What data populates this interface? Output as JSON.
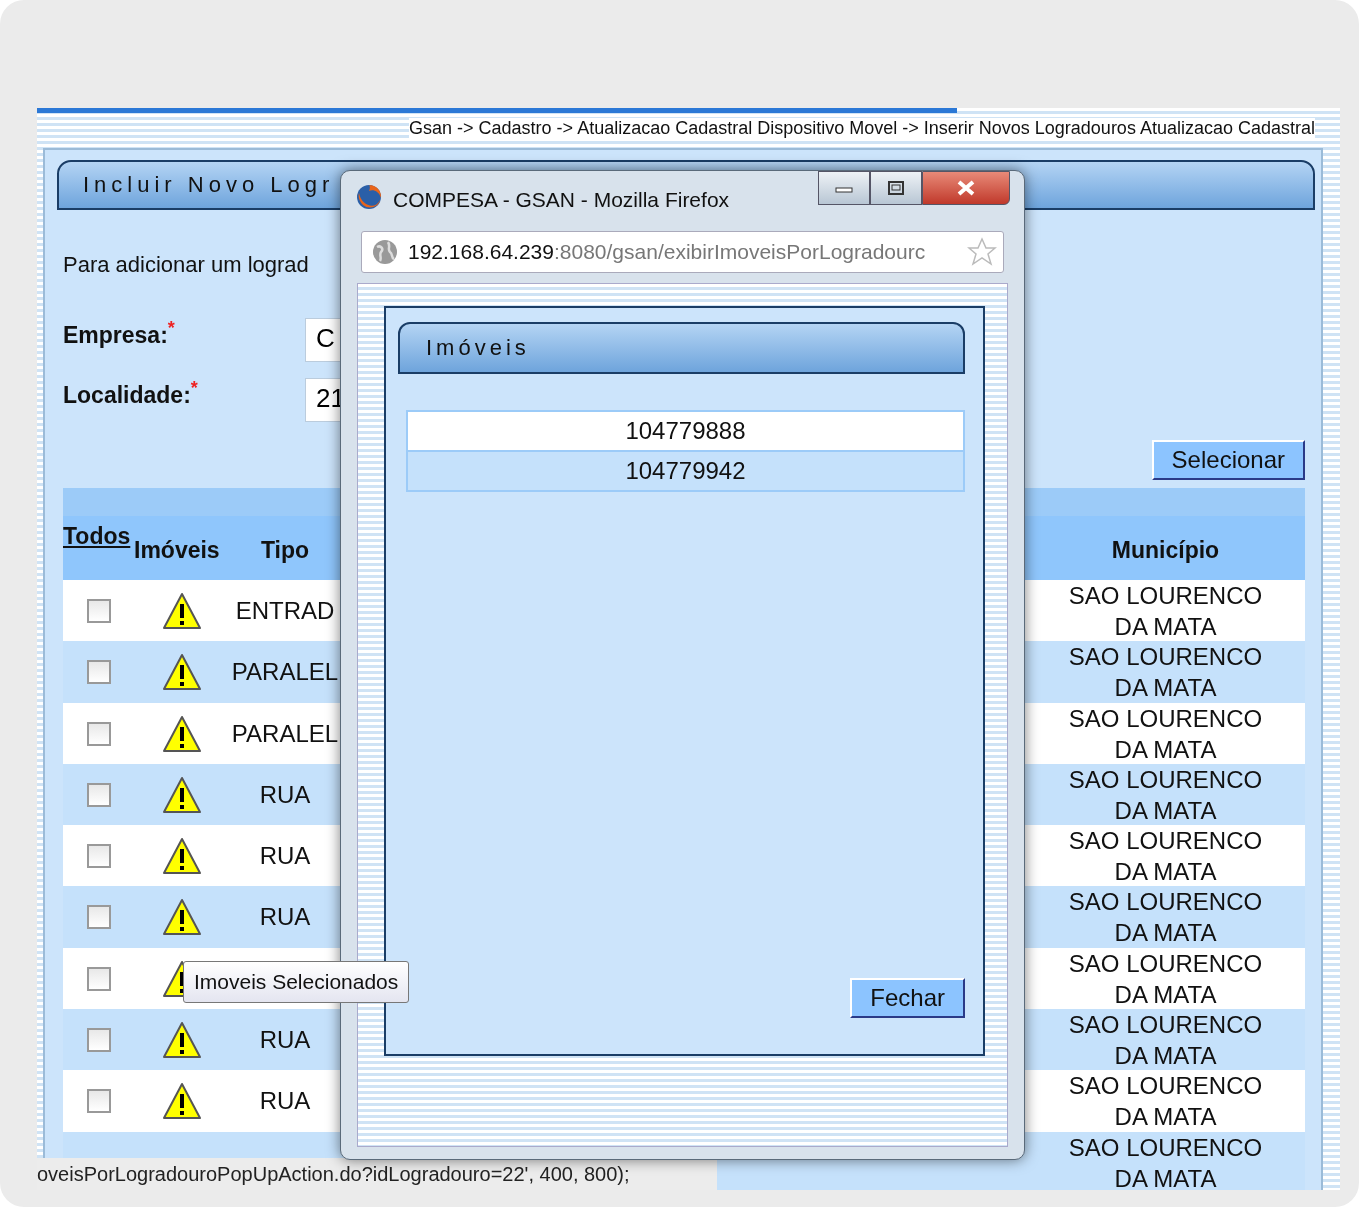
{
  "breadcrumb": "Gsan -> Cadastro -> Atualizacao Cadastral Dispositivo Movel -> Inserir Novos Logradouros Atualizacao Cadastral",
  "panel": {
    "title": "Incluir Novo Logr",
    "intro": "Para adicionar um lograd",
    "fields": [
      {
        "label": "Empresa:",
        "required_mark": "*",
        "value": "C"
      },
      {
        "label": "Localidade:",
        "required_mark": "*",
        "value": "21"
      }
    ],
    "select_button": "Selecionar"
  },
  "table": {
    "columns": [
      "Todos",
      "Imóveis",
      "Tipo",
      "Município"
    ],
    "rows": [
      {
        "checked": false,
        "tipo": "ENTRAD",
        "municipio": "SAO LOURENCO DA MATA"
      },
      {
        "checked": false,
        "tipo": "PARALEL",
        "municipio": "SAO LOURENCO DA MATA"
      },
      {
        "checked": false,
        "tipo": "PARALEL",
        "municipio": "SAO LOURENCO DA MATA"
      },
      {
        "checked": false,
        "tipo": "RUA",
        "municipio": "SAO LOURENCO DA MATA"
      },
      {
        "checked": false,
        "tipo": "RUA",
        "municipio": "SAO LOURENCO DA MATA"
      },
      {
        "checked": false,
        "tipo": "RUA",
        "municipio": "SAO LOURENCO DA MATA"
      },
      {
        "checked": false,
        "municipio": "SAO LOURENCO DA MATA"
      },
      {
        "checked": false,
        "tipo": "RUA",
        "municipio": "SAO LOURENCO DA MATA"
      },
      {
        "checked": false,
        "tipo": "RUA",
        "municipio": "SAO LOURENCO DA MATA"
      },
      {
        "municipio": "SAO LOURENCO DA MATA"
      }
    ]
  },
  "tooltip": "Imoveis Selecionados",
  "status_bar": "oveisPorLogradouroPopUpAction.do?idLogradouro=22', 400, 800);",
  "popup": {
    "title": "COMPESA - GSAN - Mozilla Firefox",
    "url_host": "192.168.64.239",
    "url_rest": ":8080/gsan/exibirImoveisPorLogradourc",
    "heading": "Imóveis",
    "items": [
      "104779888",
      "104779942"
    ],
    "close_button": "Fechar"
  }
}
